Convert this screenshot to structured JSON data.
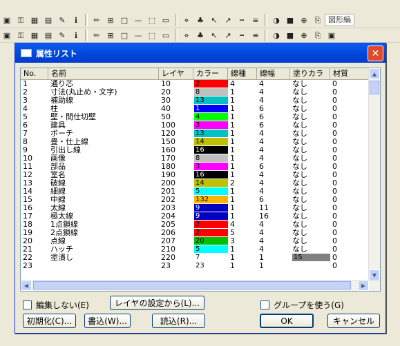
{
  "background_toolbar": {
    "row1_icons": [
      "save-icon",
      "key-icon",
      "select-icon",
      "grid-icon",
      "edit-icon",
      "text-icon",
      "pencil-icon",
      "dimension-icon",
      "rect-icon",
      "line-icon",
      "rect-select-icon",
      "box-icon",
      "node-icon",
      "people-icon",
      "pointer-icon",
      "arrow-icon",
      "dash-line-icon",
      "lines-icon",
      "stamp-icon",
      "block-icon",
      "and-icon",
      "paste-icon"
    ],
    "row1_text_field": "図形編",
    "row2_icons": [
      "circle-icon",
      "polygon-icon",
      "curve-icon",
      "house-icon",
      "tool-icon",
      "arc-icon",
      "pen-icon",
      "hatch-icon",
      "star-icon",
      "wall-icon",
      "column-icon",
      "door-icon",
      "plan-icon",
      "layer1-icon",
      "layer2-icon",
      "layer3-icon",
      "layer4-icon",
      "layer5-icon",
      "layer6-icon",
      "layer7-icon",
      "layer8-icon",
      "layer9-icon",
      "layer10-icon"
    ]
  },
  "dialog": {
    "title": "属性リスト",
    "close_glyph": "✕",
    "columns": [
      "No.",
      "名前",
      "レイヤ",
      "カラー",
      "線種",
      "線幅",
      "塗りカラ",
      "材質"
    ],
    "rows": [
      {
        "no": "1",
        "name": "通り芯",
        "layer": "10",
        "color_no": "2",
        "color_hex": "#ff0000",
        "linetype": "4",
        "width": "4",
        "fill": "なし",
        "material": "0"
      },
      {
        "no": "2",
        "name": "寸法(丸止め・文字)",
        "layer": "20",
        "color_no": "8",
        "color_hex": "#c0c0c0",
        "linetype": "1",
        "width": "4",
        "fill": "なし",
        "material": "0"
      },
      {
        "no": "3",
        "name": "補助線",
        "layer": "30",
        "color_no": "13",
        "color_hex": "#00c0c0",
        "linetype": "1",
        "width": "4",
        "fill": "なし",
        "material": "0"
      },
      {
        "no": "4",
        "name": "柱",
        "layer": "40",
        "color_no": "1",
        "color_hex": "#0000ff",
        "linetype": "1",
        "width": "6",
        "fill": "なし",
        "material": "0"
      },
      {
        "no": "5",
        "name": "壁・間仕切壁",
        "layer": "50",
        "color_no": "4",
        "color_hex": "#00ff00",
        "linetype": "1",
        "width": "6",
        "fill": "なし",
        "material": "0"
      },
      {
        "no": "6",
        "name": "建具",
        "layer": "100",
        "color_no": "3",
        "color_hex": "#ff00ff",
        "linetype": "1",
        "width": "6",
        "fill": "なし",
        "material": "0"
      },
      {
        "no": "7",
        "name": "ポーチ",
        "layer": "120",
        "color_no": "13",
        "color_hex": "#00c0c0",
        "linetype": "1",
        "width": "4",
        "fill": "なし",
        "material": "0"
      },
      {
        "no": "8",
        "name": "畳・仕上線",
        "layer": "150",
        "color_no": "14",
        "color_hex": "#c0c000",
        "linetype": "1",
        "width": "4",
        "fill": "なし",
        "material": "0"
      },
      {
        "no": "9",
        "name": "引出し線",
        "layer": "160",
        "color_no": "16",
        "color_hex": "#000000",
        "linetype": "1",
        "width": "4",
        "fill": "なし",
        "material": "0"
      },
      {
        "no": "10",
        "name": "画像",
        "layer": "170",
        "color_no": "8",
        "color_hex": "#c0c0c0",
        "linetype": "1",
        "width": "4",
        "fill": "なし",
        "material": "0"
      },
      {
        "no": "11",
        "name": "部品",
        "layer": "180",
        "color_no": "3",
        "color_hex": "#ff00ff",
        "linetype": "1",
        "width": "6",
        "fill": "なし",
        "material": "0"
      },
      {
        "no": "12",
        "name": "室名",
        "layer": "190",
        "color_no": "16",
        "color_hex": "#000000",
        "linetype": "1",
        "width": "4",
        "fill": "なし",
        "material": "0"
      },
      {
        "no": "13",
        "name": "破線",
        "layer": "200",
        "color_no": "14",
        "color_hex": "#c0c000",
        "linetype": "2",
        "width": "4",
        "fill": "なし",
        "material": "0"
      },
      {
        "no": "14",
        "name": "細線",
        "layer": "201",
        "color_no": "5",
        "color_hex": "#00ffff",
        "linetype": "1",
        "width": "4",
        "fill": "なし",
        "material": "0"
      },
      {
        "no": "15",
        "name": "中線",
        "layer": "202",
        "color_no": "132",
        "color_hex": "#ffb400",
        "linetype": "1",
        "width": "6",
        "fill": "なし",
        "material": "0"
      },
      {
        "no": "16",
        "name": "太線",
        "layer": "203",
        "color_no": "9",
        "color_hex": "#0000c0",
        "linetype": "1",
        "width": "11",
        "fill": "なし",
        "material": "0"
      },
      {
        "no": "17",
        "name": "極太線",
        "layer": "204",
        "color_no": "9",
        "color_hex": "#0000c0",
        "linetype": "1",
        "width": "16",
        "fill": "なし",
        "material": "0"
      },
      {
        "no": "18",
        "name": "1点鎖線",
        "layer": "205",
        "color_no": "2",
        "color_hex": "#ff0000",
        "linetype": "4",
        "width": "4",
        "fill": "なし",
        "material": "0"
      },
      {
        "no": "19",
        "name": "2点鎖線",
        "layer": "206",
        "color_no": "2",
        "color_hex": "#ff0000",
        "linetype": "5",
        "width": "4",
        "fill": "なし",
        "material": "0"
      },
      {
        "no": "20",
        "name": "点線",
        "layer": "207",
        "color_no": "20",
        "color_hex": "#00c000",
        "linetype": "3",
        "width": "4",
        "fill": "なし",
        "material": "0"
      },
      {
        "no": "21",
        "name": "ハッチ",
        "layer": "210",
        "color_no": "5",
        "color_hex": "#00ffff",
        "linetype": "1",
        "width": "4",
        "fill": "なし",
        "material": "0"
      },
      {
        "no": "22",
        "name": "塗潰し",
        "layer": "220",
        "color_no": "7",
        "color_hex": "#ffffff",
        "linetype": "1",
        "width": "1",
        "fill": "15",
        "fill_hex": "#808080",
        "material": "0"
      },
      {
        "no": "23",
        "name": "",
        "layer": "23",
        "color_no": "23",
        "color_hex": "#ffffff",
        "linetype": "1",
        "width": "1",
        "fill": "",
        "material": "0"
      }
    ],
    "checkbox_no_edit": "編集しない(E)",
    "btn_from_layer": "レイヤの設定から(L)...",
    "checkbox_use_group": "グループを使う(G)",
    "btn_init": "初期化(C)...",
    "btn_write": "書込(W)...",
    "btn_read": "読込(R)...",
    "btn_ok": "OK",
    "btn_cancel": "キャンセル"
  }
}
